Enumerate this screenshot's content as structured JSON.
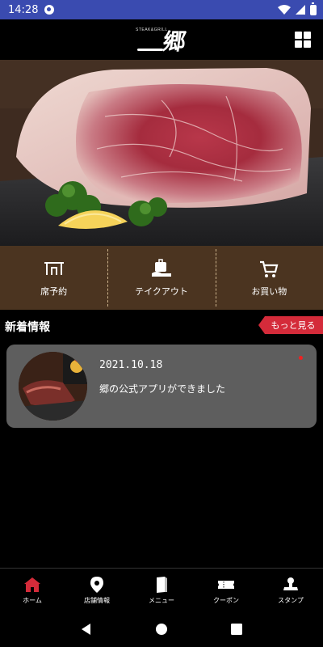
{
  "status_bar": {
    "time": "14:28",
    "icons": [
      "app-notification-icon",
      "wifi-icon",
      "cell-signal-icon",
      "battery-icon"
    ]
  },
  "header": {
    "logo_kanji": "郷",
    "logo_small_text": "STEAK&GRILL",
    "grid_icon": "grid-menu-icon"
  },
  "hero": {
    "description_icon": "steak-photo"
  },
  "menu": {
    "items": [
      {
        "label": "席予約",
        "icon": "table-reservation-icon"
      },
      {
        "label": "テイクアウト",
        "icon": "takeout-bag-icon"
      },
      {
        "label": "お買い物",
        "icon": "shopping-cart-icon"
      }
    ]
  },
  "news": {
    "title": "新着情報",
    "more_label": "もっと見る",
    "items": [
      {
        "date": "2021.10.18",
        "text": "郷の公式アプリができました"
      }
    ]
  },
  "bottom_nav": {
    "items": [
      {
        "label": "ホーム",
        "icon": "home-icon"
      },
      {
        "label": "店舗情報",
        "icon": "location-pin-icon"
      },
      {
        "label": "メニュー",
        "icon": "menu-book-icon"
      },
      {
        "label": "クーポン",
        "icon": "coupon-ticket-icon"
      },
      {
        "label": "スタンプ",
        "icon": "stamp-icon"
      }
    ]
  },
  "colors": {
    "status_bar": "#3a4bb0",
    "menu_bg": "#4b3420",
    "accent_red": "#d42b3a",
    "active_nav": "#d42b3a",
    "card_bg": "#5e5e5e"
  }
}
